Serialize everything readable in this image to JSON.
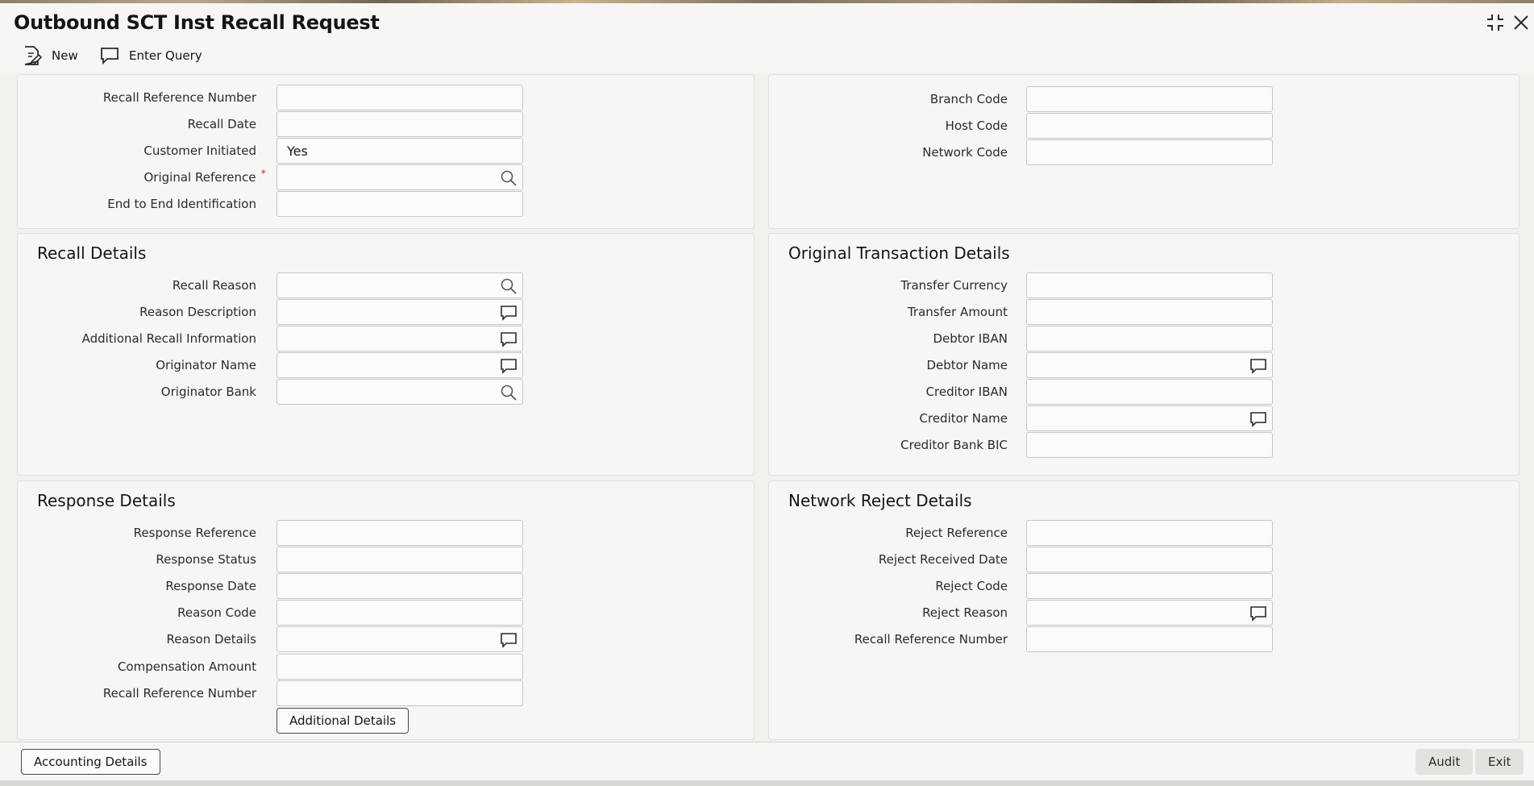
{
  "window": {
    "title": "Outbound SCT Inst Recall Request"
  },
  "toolbar": {
    "new_label": "New",
    "enter_query_label": "Enter Query"
  },
  "header_left": {
    "recall_reference_number": {
      "label": "Recall Reference Number",
      "value": ""
    },
    "recall_date": {
      "label": "Recall Date",
      "value": ""
    },
    "customer_initiated": {
      "label": "Customer Initiated",
      "value": "Yes"
    },
    "original_reference": {
      "label": "Original Reference",
      "required_mark": "*",
      "value": ""
    },
    "end_to_end_identification": {
      "label": "End to End Identification",
      "value": ""
    }
  },
  "header_right": {
    "branch_code": {
      "label": "Branch Code",
      "value": ""
    },
    "host_code": {
      "label": "Host Code",
      "value": ""
    },
    "network_code": {
      "label": "Network Code",
      "value": ""
    }
  },
  "recall_details": {
    "title": "Recall Details",
    "recall_reason": {
      "label": "Recall Reason",
      "value": ""
    },
    "reason_description": {
      "label": "Reason Description",
      "value": ""
    },
    "additional_recall_information": {
      "label": "Additional Recall Information",
      "value": ""
    },
    "originator_name": {
      "label": "Originator Name",
      "value": ""
    },
    "originator_bank": {
      "label": "Originator Bank",
      "value": ""
    }
  },
  "original_transaction_details": {
    "title": "Original Transaction Details",
    "transfer_currency": {
      "label": "Transfer Currency",
      "value": ""
    },
    "transfer_amount": {
      "label": "Transfer Amount",
      "value": ""
    },
    "debtor_iban": {
      "label": "Debtor IBAN",
      "value": ""
    },
    "debtor_name": {
      "label": "Debtor Name",
      "value": ""
    },
    "creditor_iban": {
      "label": "Creditor IBAN",
      "value": ""
    },
    "creditor_name": {
      "label": "Creditor Name",
      "value": ""
    },
    "creditor_bank_bic": {
      "label": "Creditor Bank BIC",
      "value": ""
    }
  },
  "response_details": {
    "title": "Response Details",
    "response_reference": {
      "label": "Response Reference",
      "value": ""
    },
    "response_status": {
      "label": "Response Status",
      "value": ""
    },
    "response_date": {
      "label": "Response Date",
      "value": ""
    },
    "reason_code": {
      "label": "Reason Code",
      "value": ""
    },
    "reason_details": {
      "label": "Reason Details",
      "value": ""
    },
    "compensation_amount": {
      "label": "Compensation Amount",
      "value": ""
    },
    "recall_reference_number": {
      "label": "Recall Reference Number",
      "value": ""
    },
    "additional_details_button": "Additional Details"
  },
  "network_reject_details": {
    "title": "Network Reject Details",
    "reject_reference": {
      "label": "Reject Reference",
      "value": ""
    },
    "reject_received_date": {
      "label": "Reject Received Date",
      "value": ""
    },
    "reject_code": {
      "label": "Reject Code",
      "value": ""
    },
    "reject_reason": {
      "label": "Reject Reason",
      "value": ""
    },
    "recall_reference_number": {
      "label": "Recall Reference Number",
      "value": ""
    }
  },
  "footer": {
    "accounting_details_button": "Accounting Details",
    "audit_button": "Audit",
    "exit_button": "Exit"
  },
  "icons": [
    "new-icon",
    "enter-query-icon",
    "search-icon",
    "comment-icon",
    "collapse-icon",
    "close-icon"
  ]
}
